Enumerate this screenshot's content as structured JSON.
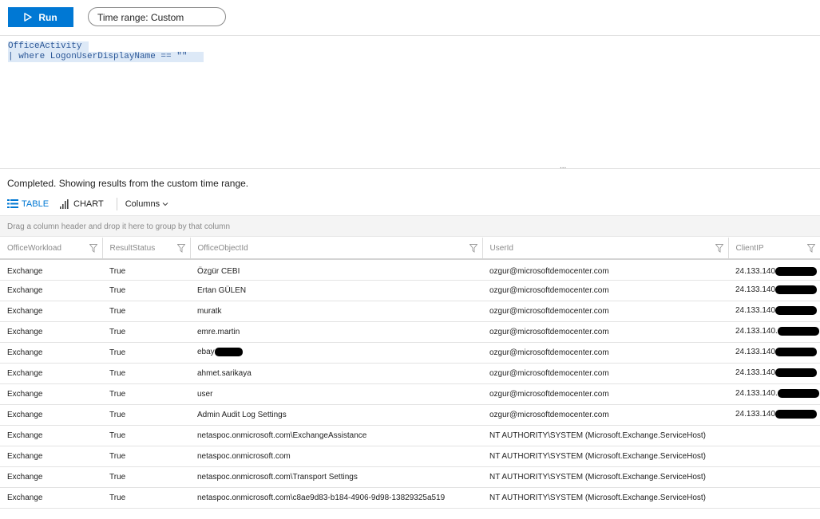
{
  "toolbar": {
    "run_label": "Run",
    "time_range_label": "Time range: Custom"
  },
  "query": {
    "lines": [
      "OfficeActivity",
      "| where LogonUserDisplayName == \"\""
    ]
  },
  "splitter_glyph": "...",
  "results": {
    "status": "Completed. Showing results from the custom time range.",
    "tabs": {
      "table": "TABLE",
      "chart": "CHART"
    },
    "columns_label": "Columns",
    "group_hint": "Drag a column header and drop it here to group by that column",
    "columns": [
      "OfficeWorkload",
      "ResultStatus",
      "OfficeObjectId",
      "UserId",
      "ClientIP"
    ],
    "rows": [
      {
        "OfficeWorkload": "Exchange",
        "ResultStatus": "True",
        "OfficeObjectId": "Özgür CEBI",
        "UserId": "ozgur@microsoftdemocenter.com",
        "ClientIP": "24.133.140"
      },
      {
        "OfficeWorkload": "Exchange",
        "ResultStatus": "True",
        "OfficeObjectId": "Ertan GÜLEN",
        "UserId": "ozgur@microsoftdemocenter.com",
        "ClientIP": "24.133.140"
      },
      {
        "OfficeWorkload": "Exchange",
        "ResultStatus": "True",
        "OfficeObjectId": "muratk",
        "UserId": "ozgur@microsoftdemocenter.com",
        "ClientIP": "24.133.140"
      },
      {
        "OfficeWorkload": "Exchange",
        "ResultStatus": "True",
        "OfficeObjectId": "emre.martin",
        "UserId": "ozgur@microsoftdemocenter.com",
        "ClientIP": "24.133.140."
      },
      {
        "OfficeWorkload": "Exchange",
        "ResultStatus": "True",
        "OfficeObjectId": "ebay",
        "UserId": "ozgur@microsoftdemocenter.com",
        "ClientIP": "24.133.140"
      },
      {
        "OfficeWorkload": "Exchange",
        "ResultStatus": "True",
        "OfficeObjectId": "ahmet.sarikaya",
        "UserId": "ozgur@microsoftdemocenter.com",
        "ClientIP": "24.133.140"
      },
      {
        "OfficeWorkload": "Exchange",
        "ResultStatus": "True",
        "OfficeObjectId": "user",
        "UserId": "ozgur@microsoftdemocenter.com",
        "ClientIP": "24.133.140."
      },
      {
        "OfficeWorkload": "Exchange",
        "ResultStatus": "True",
        "OfficeObjectId": "Admin Audit Log Settings",
        "UserId": "ozgur@microsoftdemocenter.com",
        "ClientIP": "24.133.140"
      },
      {
        "OfficeWorkload": "Exchange",
        "ResultStatus": "True",
        "OfficeObjectId": "netaspoc.onmicrosoft.com\\ExchangeAssistance",
        "UserId": "NT AUTHORITY\\SYSTEM (Microsoft.Exchange.ServiceHost)",
        "ClientIP": ""
      },
      {
        "OfficeWorkload": "Exchange",
        "ResultStatus": "True",
        "OfficeObjectId": "netaspoc.onmicrosoft.com",
        "UserId": "NT AUTHORITY\\SYSTEM (Microsoft.Exchange.ServiceHost)",
        "ClientIP": ""
      },
      {
        "OfficeWorkload": "Exchange",
        "ResultStatus": "True",
        "OfficeObjectId": "netaspoc.onmicrosoft.com\\Transport Settings",
        "UserId": "NT AUTHORITY\\SYSTEM (Microsoft.Exchange.ServiceHost)",
        "ClientIP": ""
      },
      {
        "OfficeWorkload": "Exchange",
        "ResultStatus": "True",
        "OfficeObjectId": "netaspoc.onmicrosoft.com\\c8ae9d83-b184-4906-9d98-13829325a519",
        "UserId": "NT AUTHORITY\\SYSTEM (Microsoft.Exchange.ServiceHost)",
        "ClientIP": ""
      }
    ]
  },
  "icons": {
    "run": "play-icon",
    "table": "table-icon",
    "chart": "bar-chart-icon",
    "columns": "chevron-down-icon",
    "filter": "filter-icon",
    "redaction": "redaction-mark"
  },
  "colors": {
    "accent": "#0078d4",
    "query_highlight": "#dde9f7",
    "query_text": "#2b5797",
    "group_bar": "#f4f4f4"
  }
}
